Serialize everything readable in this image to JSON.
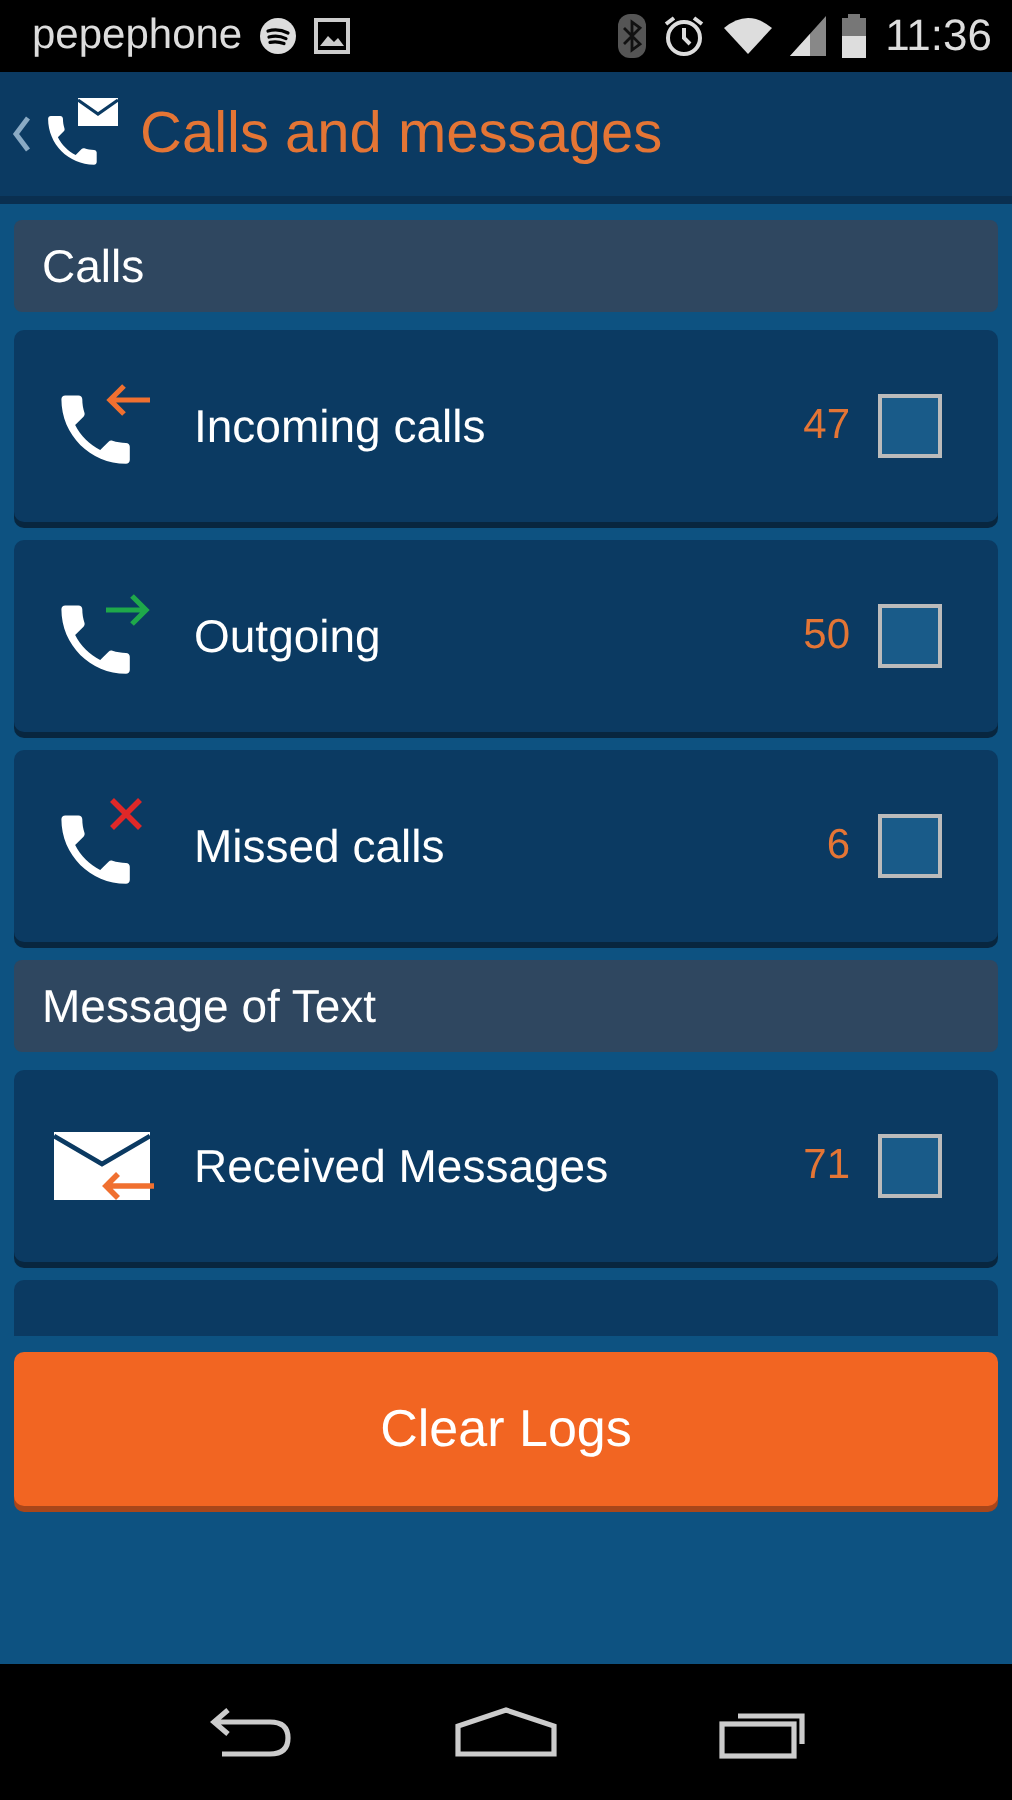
{
  "status_bar": {
    "carrier": "pepephone",
    "time": "11:36"
  },
  "app_bar": {
    "title": "Calls and messages"
  },
  "sections": [
    {
      "title": "Calls",
      "items": [
        {
          "kind": "incoming",
          "label": "Incoming calls",
          "count": "47",
          "checked": false
        },
        {
          "kind": "outgoing",
          "label": "Outgoing",
          "count": "50",
          "checked": false
        },
        {
          "kind": "missed",
          "label": "Missed calls",
          "count": "6",
          "checked": false
        }
      ]
    },
    {
      "title": "Message of Text",
      "items": [
        {
          "kind": "received_sms",
          "label": "Received Messages",
          "count": "71",
          "checked": false
        }
      ]
    }
  ],
  "clear_button": {
    "label": "Clear Logs"
  }
}
